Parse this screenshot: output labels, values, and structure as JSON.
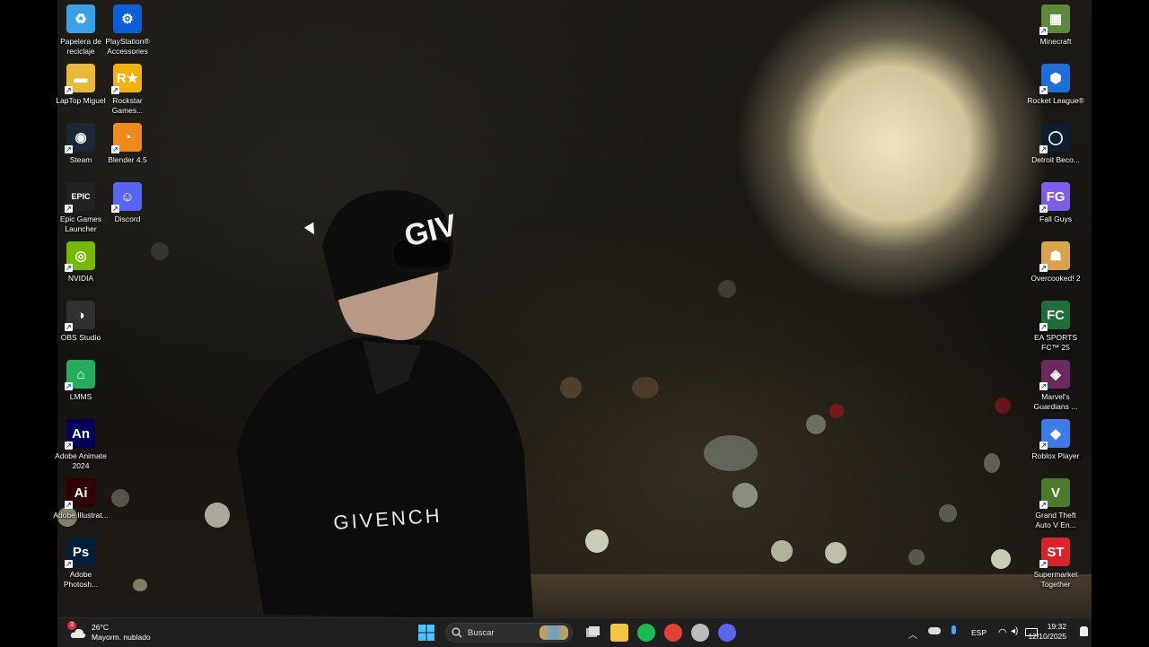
{
  "desktop": {
    "left_icons": [
      {
        "label": "Papelera de reciclaje",
        "icon": "recycle-bin-icon",
        "color": "#3aa0e8"
      },
      {
        "label": "PlayStation® Accessories",
        "icon": "playstation-accessories-icon",
        "color": "#0b5fd6"
      },
      {
        "label": "LapTop Miguel",
        "icon": "folder-icon",
        "color": "#e8b93a"
      },
      {
        "label": "Rockstar Games...",
        "icon": "rockstar-icon",
        "color": "#f2b20c"
      },
      {
        "label": "Steam",
        "icon": "steam-icon",
        "color": "#1b2838"
      },
      {
        "label": "Blender 4.5",
        "icon": "blender-icon",
        "color": "#f08a1c"
      },
      {
        "label": "Epic Games Launcher",
        "icon": "epic-games-icon",
        "color": "#222222"
      },
      {
        "label": "Discord",
        "icon": "discord-icon",
        "color": "#5865f2"
      },
      {
        "label": "NVIDIA",
        "icon": "nvidia-icon",
        "color": "#76b900"
      },
      {
        "label": "OBS Studio",
        "icon": "obs-icon",
        "color": "#303030"
      },
      {
        "label": "LMMS",
        "icon": "lmms-icon",
        "color": "#27ab5f"
      },
      {
        "label": "Adobe Animate 2024",
        "icon": "adobe-animate-icon",
        "color": "#00005b"
      },
      {
        "label": "Adobe Illustrat...",
        "icon": "adobe-illustrator-icon",
        "color": "#330000"
      },
      {
        "label": "Adobe Photosh...",
        "icon": "adobe-photoshop-icon",
        "color": "#001e36"
      }
    ],
    "right_icons": [
      {
        "label": "Minecraft",
        "icon": "minecraft-icon",
        "color": "#5c8a3a"
      },
      {
        "label": "Rocket League®",
        "icon": "rocket-league-icon",
        "color": "#1d6fd6"
      },
      {
        "label": "Detroit Beco...",
        "icon": "detroit-become-human-icon",
        "color": "#0c1e30"
      },
      {
        "label": "Fall Guys",
        "icon": "fall-guys-icon",
        "color": "#7e5de8"
      },
      {
        "label": "Overcooked! 2",
        "icon": "overcooked-icon",
        "color": "#d9a34a"
      },
      {
        "label": "EA SPORTS FC™ 25",
        "icon": "ea-sports-fc-icon",
        "color": "#1f6e3a"
      },
      {
        "label": "Marvel's Guardians ...",
        "icon": "guardians-galaxy-icon",
        "color": "#6a2a5e"
      },
      {
        "label": "Roblox Player",
        "icon": "roblox-icon",
        "color": "#3d7be8"
      },
      {
        "label": "Grand Theft Auto V En...",
        "icon": "gta-v-icon",
        "color": "#4a7a2a"
      },
      {
        "label": "Supermarket Together",
        "icon": "supermarket-together-icon",
        "color": "#d8232a"
      }
    ]
  },
  "glyphs": {
    "Papelera de reciclaje": "♻",
    "PlayStation® Accessories": "⚙",
    "LapTop Miguel": "▬",
    "Rockstar Games...": "R★",
    "Steam": "◉",
    "Blender 4.5": "◔",
    "Epic Games Launcher": "EPIC",
    "Discord": "☺",
    "NVIDIA": "◎",
    "OBS Studio": "◑",
    "LMMS": "⌂",
    "Adobe Animate 2024": "An",
    "Adobe Illustrat...": "Ai",
    "Adobe Photosh...": "Ps",
    "Minecraft": "▦",
    "Rocket League®": "⬢",
    "Detroit Beco...": "◯",
    "Fall Guys": "FG",
    "Overcooked! 2": "☗",
    "EA SPORTS FC™ 25": "FC",
    "Marvel's Guardians ...": "◈",
    "Roblox Player": "◆",
    "Grand Theft Auto V En...": "V",
    "Supermarket Together": "ST"
  },
  "wallpaper": {
    "logo_hat": "GIV",
    "logo_shirt": "GIVENCH"
  },
  "taskbar": {
    "weather": {
      "temp": "26°C",
      "desc": "Mayorm. nublado",
      "badge": "3"
    },
    "search_placeholder": "Buscar",
    "apps": [
      {
        "icon": "file-explorer-icon",
        "color": "#f5c542"
      },
      {
        "icon": "spotify-icon",
        "color": "#1db954"
      },
      {
        "icon": "chrome-icon",
        "color": "#e34133"
      },
      {
        "icon": "unknown-app-icon",
        "color": "#bbbbbb"
      },
      {
        "icon": "discord-icon",
        "color": "#5865f2"
      }
    ],
    "lang": "ESP",
    "time": "19:32",
    "date": "12/10/2025"
  }
}
